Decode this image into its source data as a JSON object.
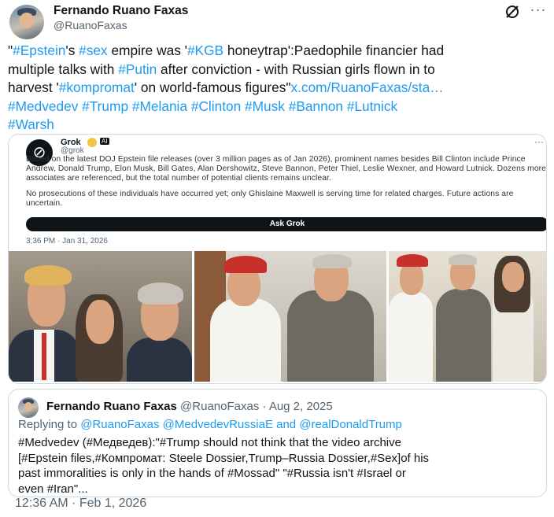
{
  "author": {
    "name": "Fernando Ruano Faxas",
    "handle": "@RuanoFaxas"
  },
  "actions": {
    "grok_icon": "grok-icon",
    "more_icon": "more-icon",
    "more_label": "···"
  },
  "tweet": {
    "lines": [
      [
        {
          "t": "\"",
          "c": "text"
        },
        {
          "t": "#Epstein",
          "c": "tag"
        },
        {
          "t": "'s ",
          "c": "text"
        },
        {
          "t": "#sex",
          "c": "tag"
        },
        {
          "t": " empire was '",
          "c": "text"
        },
        {
          "t": "#KGB",
          "c": "tag"
        },
        {
          "t": " honeytrap':Paedophile financier had",
          "c": "text"
        }
      ],
      [
        {
          "t": "multiple talks with ",
          "c": "text"
        },
        {
          "t": "#Putin",
          "c": "tag"
        },
        {
          "t": " after conviction - with Russian girls flown in to",
          "c": "text"
        }
      ],
      [
        {
          "t": "harvest '",
          "c": "text"
        },
        {
          "t": "#kompromat",
          "c": "tag"
        },
        {
          "t": "' on world-famous figures\"",
          "c": "text"
        },
        {
          "t": "x.com/RuanoFaxas/sta…",
          "c": "link"
        }
      ],
      [
        {
          "t": "#Medvedev",
          "c": "tag"
        },
        {
          "t": " ",
          "c": "text"
        },
        {
          "t": "#Trump",
          "c": "tag"
        },
        {
          "t": " ",
          "c": "text"
        },
        {
          "t": "#Melania",
          "c": "tag"
        },
        {
          "t": " ",
          "c": "text"
        },
        {
          "t": "#Clinton",
          "c": "tag"
        },
        {
          "t": " ",
          "c": "text"
        },
        {
          "t": "#Musk",
          "c": "tag"
        },
        {
          "t": " ",
          "c": "text"
        },
        {
          "t": "#Bannon",
          "c": "tag"
        },
        {
          "t": " ",
          "c": "text"
        },
        {
          "t": "#Lutnick",
          "c": "tag"
        }
      ],
      [
        {
          "t": "#Warsh",
          "c": "tag"
        }
      ]
    ]
  },
  "grok_card": {
    "name": "Grok",
    "ai_badge": "AI",
    "handle": "@grok",
    "more_label": "···",
    "paragraph1": "Based on the latest DOJ Epstein file releases (over 3 million pages as of Jan 2026), prominent names besides Bill Clinton include Prince Andrew, Donald Trump, Elon Musk, Bill Gates, Alan Dershowitz, Steve Bannon, Peter Thiel, Leslie Wexner, and Howard Lutnick. Dozens more associates are referenced, but the total number of potential clients remains unclear.",
    "paragraph2": "No prosecutions of these individuals have occurred yet; only Ghislaine Maxwell is serving time for related charges. Future actions are uncertain.",
    "ask_label": "Ask Grok",
    "time": "3:36 PM · Jan 31, 2026"
  },
  "quote": {
    "name": "Fernando Ruano Faxas",
    "meta": "@RuanoFaxas · Aug 2, 2025",
    "reply_prefix": "Replying to ",
    "reply_handles": "@RuanoFaxas @MedvedevRussiaE and @realDonaldTrump",
    "lines": [
      "#Medvedev (#Медведев):\"#Trump should not think that the video archive",
      "[#Epstein files,#Компромат: Steele Dossier,Trump–Russia Dossier,#Sex]of his",
      "past immoralities is only in the hands of #Mossad\" \"#Russia isn't #Israel or",
      "even #Iran\"..."
    ]
  },
  "timestamp": "12:36 AM · Feb 1, 2026",
  "colors": {
    "link": "#1d9bf0",
    "text": "#0f1419",
    "secondary": "#536471",
    "border": "#cfd9de"
  }
}
